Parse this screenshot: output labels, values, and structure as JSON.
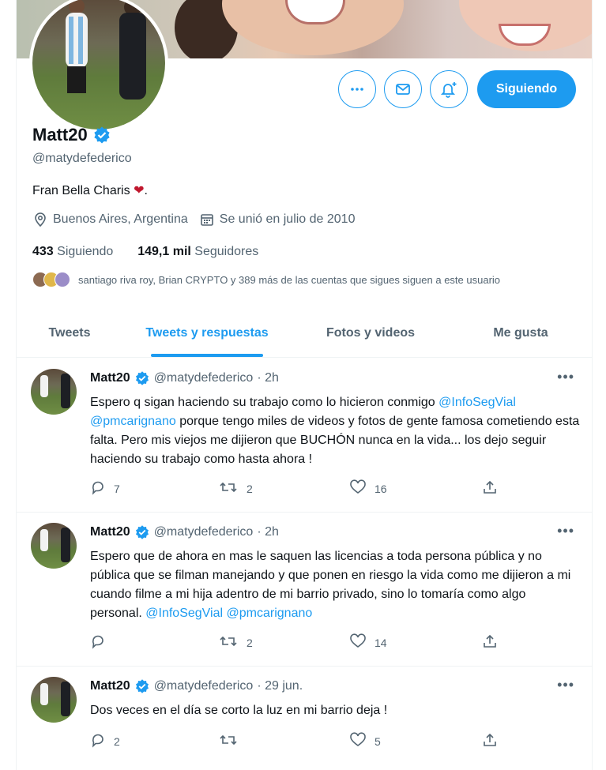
{
  "profile": {
    "name": "Matt20",
    "handle": "@matydefederico",
    "bio": "Fran Bella Charis",
    "location": "Buenos Aires, Argentina",
    "joined": "Se unió en julio de 2010",
    "following_count": "433",
    "following_label": "Siguiendo",
    "followers_count": "149,1 mil",
    "followers_label": "Seguidores",
    "followed_by": "santiago riva roy, Brian CRYPTO y 389 más de las cuentas que sigues siguen a este usuario"
  },
  "actions": {
    "more_icon": "ellipsis-icon",
    "message_icon": "envelope-icon",
    "notify_icon": "bell-plus-icon",
    "follow_label": "Siguiendo"
  },
  "tabs": [
    {
      "label": "Tweets"
    },
    {
      "label": "Tweets y respuestas"
    },
    {
      "label": "Fotos y videos"
    },
    {
      "label": "Me gusta"
    }
  ],
  "tweets": [
    {
      "name": "Matt20",
      "handle": "@matydefederico",
      "time": "· 2h",
      "text": [
        {
          "t": "Espero q sigan haciendo su trabajo como lo hicieron conmigo "
        },
        {
          "t": "@InfoSegVial",
          "link": true
        },
        {
          "t": " "
        },
        {
          "t": "@pmcarignano",
          "link": true
        },
        {
          "t": " porque tengo miles de videos y fotos de gente famosa cometiendo esta falta. Pero mis viejos me dijieron que BUCHÓN nunca en la vida... los dejo seguir haciendo su trabajo como hasta ahora !"
        }
      ],
      "replies": "7",
      "retweets": "2",
      "likes": "16"
    },
    {
      "name": "Matt20",
      "handle": "@matydefederico",
      "time": "· 2h",
      "text": [
        {
          "t": "Espero que de ahora en mas le saquen las licencias a toda persona pública y no pública que se filman manejando y que ponen en riesgo la vida como me dijieron a mi cuando filme a mi hija adentro de mi barrio privado, sino lo tomaría como algo personal. "
        },
        {
          "t": "@InfoSegVial",
          "link": true
        },
        {
          "t": " "
        },
        {
          "t": "@pmcarignano",
          "link": true
        }
      ],
      "replies": "",
      "retweets": "2",
      "likes": "14"
    },
    {
      "name": "Matt20",
      "handle": "@matydefederico",
      "time": "· 29 jun.",
      "text": [
        {
          "t": "Dos veces en el día se corto la luz en mi barrio deja !"
        }
      ],
      "replies": "2",
      "retweets": "",
      "likes": "5"
    }
  ],
  "colors": {
    "accent": "#1d9bf0",
    "text": "#0f1419",
    "muted": "#536471",
    "heart": "#c0182e"
  }
}
